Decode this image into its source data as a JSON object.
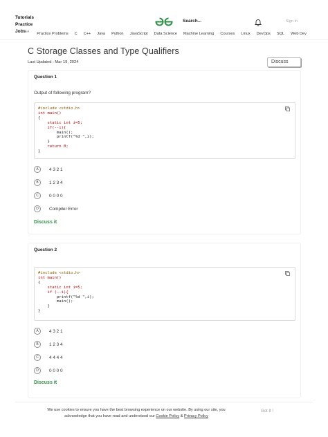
{
  "topnav": {
    "links": [
      "Tutorials",
      "Practice",
      "Jobs"
    ],
    "search_placeholder": "Search...",
    "signin": "Sign In",
    "categories": [
      "DSA",
      "Practice Problems",
      "C",
      "C++",
      "Java",
      "Python",
      "JavaScript",
      "Data Science",
      "Machine Learning",
      "Courses",
      "Linux",
      "DevOps",
      "SQL",
      "Web Dev"
    ],
    "logo_color": "#2f8d46"
  },
  "page": {
    "title": "C Storage Classes and Type Qualifiers",
    "last_updated": "Last Updated : Mar 19, 2024",
    "discuss_label": "Discuss"
  },
  "questions": [
    {
      "label": "Question 1",
      "text": "Output of following program?",
      "code": [
        "#include <stdio.h>",
        "int main()",
        "{",
        "    static int i=5;",
        "    if(--i){",
        "        main();",
        "        printf(\"%d \",i);",
        "    }",
        "    return 0;",
        "}"
      ],
      "options": [
        {
          "key": "A",
          "text": "4 3 2 1"
        },
        {
          "key": "B",
          "text": "1 2 3 4"
        },
        {
          "key": "C",
          "text": "0 0 0 0"
        },
        {
          "key": "D",
          "text": "Compiler Error"
        }
      ],
      "discuss": "Discuss it"
    },
    {
      "label": "Question 2",
      "text": "",
      "code": [
        "#include <stdio.h>",
        "int main()",
        "{",
        "    static int i=5;",
        "    if (--i){",
        "        printf(\"%d \",i);",
        "        main();",
        "    }",
        "}"
      ],
      "options": [
        {
          "key": "A",
          "text": "4 3 2 1"
        },
        {
          "key": "B",
          "text": "1 2 3 4"
        },
        {
          "key": "C",
          "text": "4 4 4 4"
        },
        {
          "key": "D",
          "text": "0 0 0 0"
        }
      ],
      "discuss": "Discuss it"
    }
  ],
  "cookie": {
    "line1": "We use cookies to ensure you have the best browsing experience on our website. By using our site, you",
    "line2_prefix": "acknowledge that you have read and understood our",
    "cookie_policy": "Cookie Policy",
    "amp": "&",
    "privacy_policy": "Privacy Policy",
    "button": "Got It !"
  }
}
